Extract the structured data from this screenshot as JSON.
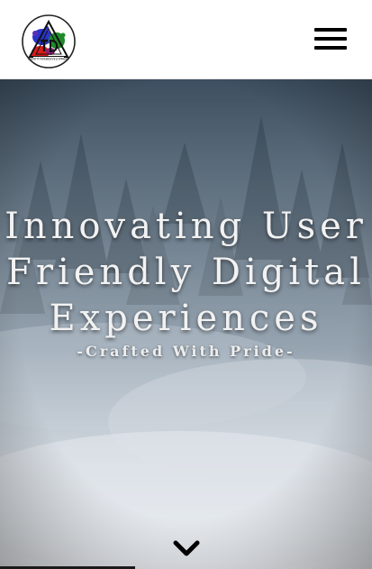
{
  "header": {
    "logo_text": "IDENTITYWEBDEVELOPMENT",
    "logo_icon": "paint-splash-logo-icon",
    "menu_icon": "hamburger-menu-icon"
  },
  "hero": {
    "headline_lines": [
      "Innovating User",
      "Friendly Digital",
      "Experiences"
    ],
    "tagline": "-Crafted With Pride-",
    "scroll_icon": "chevron-down-icon",
    "background": "misty-forest"
  },
  "colors": {
    "header_bg": "#ffffff",
    "text": "#f2f2f2",
    "menu": "#000000"
  }
}
